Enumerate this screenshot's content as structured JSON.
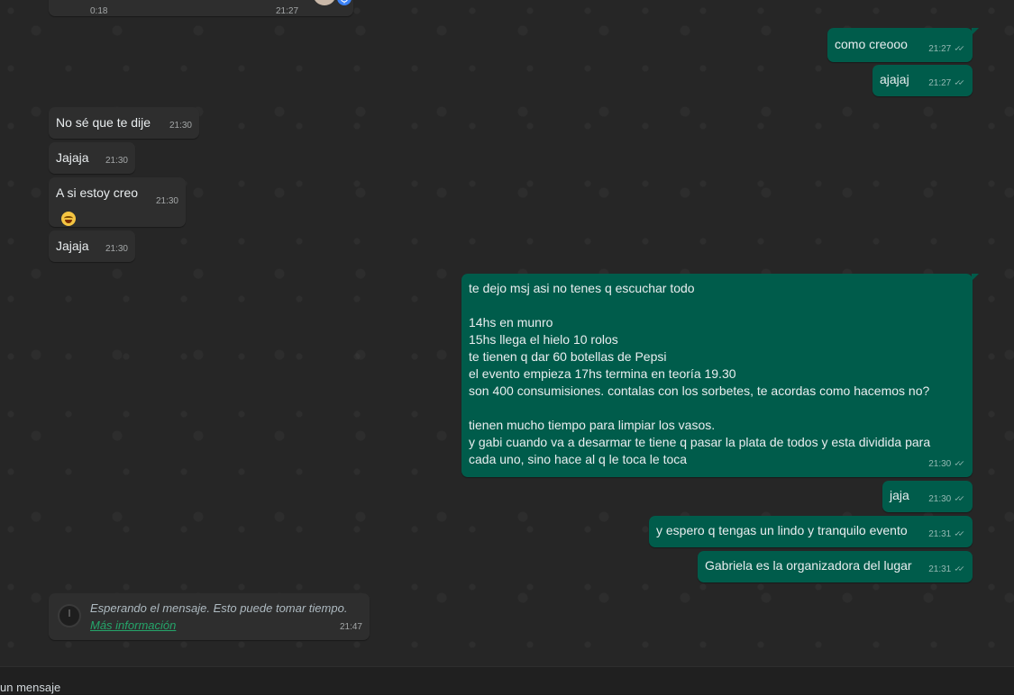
{
  "audio_top": {
    "duration": "0:18",
    "time": "21:27"
  },
  "messages": [
    {
      "id": "m1",
      "dir": "out",
      "text": "como creooo",
      "time": "21:27",
      "ticks": "✓✓"
    },
    {
      "id": "m2",
      "dir": "out",
      "text": "ajajaj",
      "time": "21:27",
      "ticks": "✓✓"
    },
    {
      "id": "m3",
      "dir": "in",
      "text": "No sé que te dije",
      "time": "21:30"
    },
    {
      "id": "m4",
      "dir": "in",
      "text": "Jajaja",
      "time": "21:30"
    },
    {
      "id": "m5",
      "dir": "in",
      "text": "A si estoy creo",
      "time": "21:30",
      "emoji": "grinning-squinting-face"
    },
    {
      "id": "m6",
      "dir": "in",
      "text": "Jajaja",
      "time": "21:30"
    },
    {
      "id": "m7",
      "dir": "out",
      "text": "te dejo msj asi no tenes q escuchar todo\n\n14hs en munro\n15hs llega el hielo 10 rolos\nte tienen q dar 60 botellas de Pepsi\nel evento empieza 17hs termina en teoría 19.30\nson 400 consumisiones. contalas con los sorbetes, te acordas como hacemos no?\n\ntienen mucho tiempo para limpiar los vasos.\ny gabi cuando va a desarmar te tiene q pasar la plata de todos y esta dividida para cada uno, sino hace al q le toca le toca",
      "time": "21:30",
      "ticks": "✓✓"
    },
    {
      "id": "m8",
      "dir": "out",
      "text": "jaja",
      "time": "21:30",
      "ticks": "✓✓"
    },
    {
      "id": "m9",
      "dir": "out",
      "text": "y espero q tengas un lindo y tranquilo evento",
      "time": "21:31",
      "ticks": "✓✓"
    },
    {
      "id": "m10",
      "dir": "out",
      "text": "Gabriela es la organizadora del lugar",
      "time": "21:31",
      "ticks": "✓✓"
    }
  ],
  "waiting": {
    "text": "Esperando el mensaje. Esto puede tomar tiempo.",
    "link": "Más información",
    "time": "21:47"
  },
  "composer": {
    "placeholder": "un mensaje"
  },
  "colors": {
    "incoming": "#2e2e2e",
    "outgoing": "#005c4b",
    "link": "#25a56a",
    "mic_badge": "#3b82f6"
  }
}
